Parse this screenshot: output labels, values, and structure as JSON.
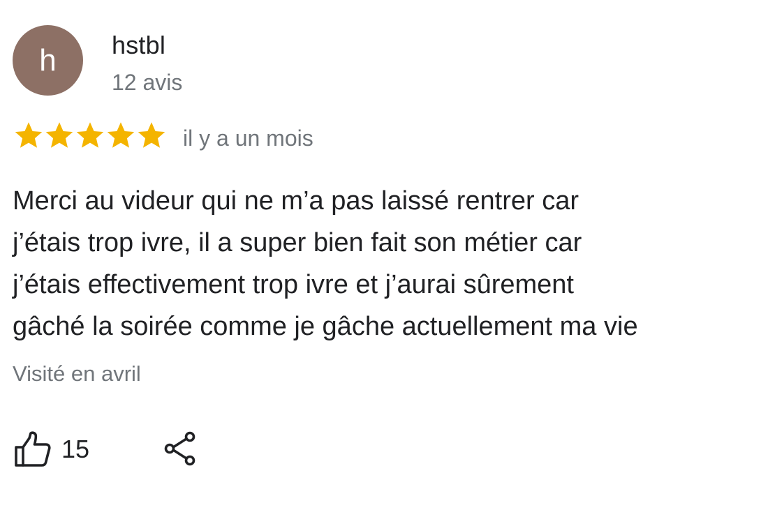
{
  "review": {
    "author": {
      "initial": "h",
      "name": "hstbl",
      "review_count": "12 avis",
      "avatar_color": "#8d7065"
    },
    "rating": {
      "stars": 5,
      "max": 5,
      "color": "#f4b400"
    },
    "time_ago": "il y a un mois",
    "text_lines": [
      "Merci au videur qui ne m’a pas laissé rentrer car",
      "j’étais trop ivre, il a super bien fait son métier car",
      "j’étais effectivement trop ivre et j’aurai sûrement",
      "gâché la soirée comme je gâche actuellement ma vie"
    ],
    "visited": "Visité en avril",
    "actions": {
      "like_icon": "thumbs-up-icon",
      "like_count": "15",
      "share_icon": "share-icon"
    }
  }
}
